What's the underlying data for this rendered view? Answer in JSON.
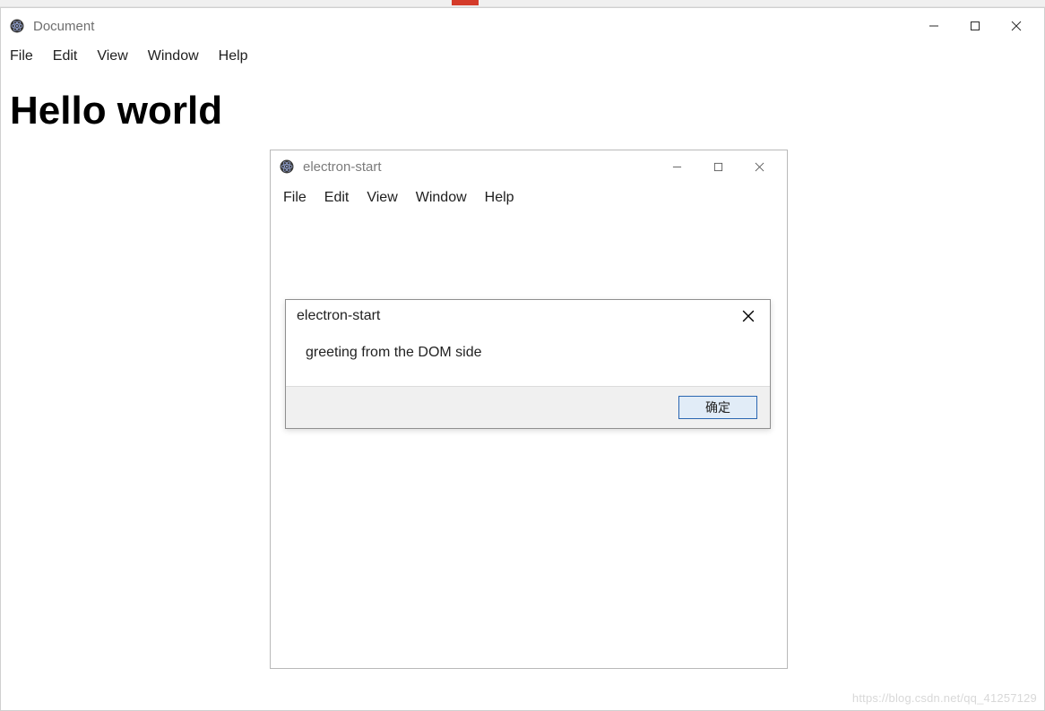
{
  "main_window": {
    "title": "Document",
    "menu": [
      "File",
      "Edit",
      "View",
      "Window",
      "Help"
    ],
    "heading": "Hello world"
  },
  "secondary_window": {
    "title": "electron-start",
    "menu": [
      "File",
      "Edit",
      "View",
      "Window",
      "Help"
    ]
  },
  "dialog": {
    "title": "electron-start",
    "message": "greeting from the DOM side",
    "ok_label": "确定"
  },
  "watermark": "https://blog.csdn.net/qq_41257129"
}
